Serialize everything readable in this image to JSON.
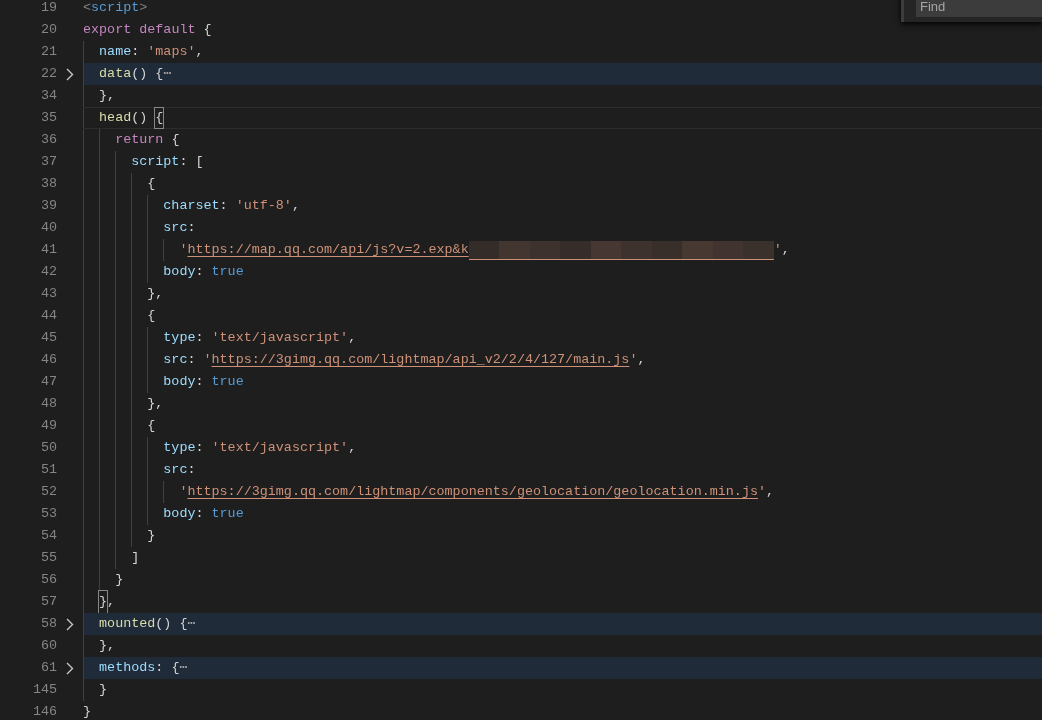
{
  "editor": {
    "lines": [
      {
        "number": "19",
        "folded": false,
        "current": false,
        "tokens": [
          {
            "kind": "tag-punct",
            "text": "<"
          },
          {
            "kind": "tag",
            "text": "script"
          },
          {
            "kind": "tag-punct",
            "text": ">"
          }
        ]
      },
      {
        "number": "20",
        "folded": false,
        "current": false,
        "tokens": [
          {
            "kind": "keyword",
            "text": "export"
          },
          {
            "kind": "keyword",
            "text": " default"
          },
          {
            "kind": "punct",
            "text": " {"
          }
        ]
      },
      {
        "number": "21",
        "folded": false,
        "current": false,
        "tokens": [
          {
            "kind": "property",
            "text": "  name"
          },
          {
            "kind": "punct",
            "text": ": "
          },
          {
            "kind": "string",
            "text": "'maps'"
          },
          {
            "kind": "punct",
            "text": ","
          }
        ]
      },
      {
        "number": "22",
        "folded": true,
        "current": false,
        "tokens": [
          {
            "kind": "function",
            "text": "  data"
          },
          {
            "kind": "punct",
            "text": "() {"
          },
          {
            "kind": "ellipsis",
            "text": "⋯"
          }
        ]
      },
      {
        "number": "34",
        "folded": false,
        "current": false,
        "tokens": [
          {
            "kind": "punct",
            "text": "  },"
          }
        ]
      },
      {
        "number": "35",
        "folded": false,
        "current": true,
        "tokens": [
          {
            "kind": "function",
            "text": "  head"
          },
          {
            "kind": "punct",
            "text": "() "
          },
          {
            "kind": "matched-bracket",
            "text": "{"
          }
        ]
      },
      {
        "number": "36",
        "folded": false,
        "current": false,
        "tokens": [
          {
            "kind": "keyword",
            "text": "    return"
          },
          {
            "kind": "punct",
            "text": " {"
          }
        ]
      },
      {
        "number": "37",
        "folded": false,
        "current": false,
        "tokens": [
          {
            "kind": "property",
            "text": "      script"
          },
          {
            "kind": "punct",
            "text": ": ["
          }
        ]
      },
      {
        "number": "38",
        "folded": false,
        "current": false,
        "tokens": [
          {
            "kind": "punct",
            "text": "        {"
          }
        ]
      },
      {
        "number": "39",
        "folded": false,
        "current": false,
        "tokens": [
          {
            "kind": "property",
            "text": "          charset"
          },
          {
            "kind": "punct",
            "text": ": "
          },
          {
            "kind": "string",
            "text": "'utf-8'"
          },
          {
            "kind": "punct",
            "text": ","
          }
        ]
      },
      {
        "number": "40",
        "folded": false,
        "current": false,
        "tokens": [
          {
            "kind": "property",
            "text": "          src"
          },
          {
            "kind": "punct",
            "text": ":"
          }
        ]
      },
      {
        "number": "41",
        "folded": false,
        "current": false,
        "tokens": [
          {
            "kind": "string",
            "text": "            '"
          },
          {
            "kind": "link",
            "text": "https://map.qq.com/api/js?v=2.exp&k"
          },
          {
            "kind": "redacted"
          },
          {
            "kind": "string",
            "text": "'"
          },
          {
            "kind": "punct",
            "text": ","
          }
        ]
      },
      {
        "number": "42",
        "folded": false,
        "current": false,
        "tokens": [
          {
            "kind": "property",
            "text": "          body"
          },
          {
            "kind": "punct",
            "text": ": "
          },
          {
            "kind": "boolean",
            "text": "true"
          }
        ]
      },
      {
        "number": "43",
        "folded": false,
        "current": false,
        "tokens": [
          {
            "kind": "punct",
            "text": "        },"
          }
        ]
      },
      {
        "number": "44",
        "folded": false,
        "current": false,
        "tokens": [
          {
            "kind": "punct",
            "text": "        {"
          }
        ]
      },
      {
        "number": "45",
        "folded": false,
        "current": false,
        "tokens": [
          {
            "kind": "property",
            "text": "          type"
          },
          {
            "kind": "punct",
            "text": ": "
          },
          {
            "kind": "string",
            "text": "'text/javascript'"
          },
          {
            "kind": "punct",
            "text": ","
          }
        ]
      },
      {
        "number": "46",
        "folded": false,
        "current": false,
        "tokens": [
          {
            "kind": "property",
            "text": "          src"
          },
          {
            "kind": "punct",
            "text": ": "
          },
          {
            "kind": "string",
            "text": "'"
          },
          {
            "kind": "link",
            "text": "https://3gimg.qq.com/lightmap/api_v2/2/4/127/main.js"
          },
          {
            "kind": "string",
            "text": "'"
          },
          {
            "kind": "punct",
            "text": ","
          }
        ]
      },
      {
        "number": "47",
        "folded": false,
        "current": false,
        "tokens": [
          {
            "kind": "property",
            "text": "          body"
          },
          {
            "kind": "punct",
            "text": ": "
          },
          {
            "kind": "boolean",
            "text": "true"
          }
        ]
      },
      {
        "number": "48",
        "folded": false,
        "current": false,
        "tokens": [
          {
            "kind": "punct",
            "text": "        },"
          }
        ]
      },
      {
        "number": "49",
        "folded": false,
        "current": false,
        "tokens": [
          {
            "kind": "punct",
            "text": "        {"
          }
        ]
      },
      {
        "number": "50",
        "folded": false,
        "current": false,
        "tokens": [
          {
            "kind": "property",
            "text": "          type"
          },
          {
            "kind": "punct",
            "text": ": "
          },
          {
            "kind": "string",
            "text": "'text/javascript'"
          },
          {
            "kind": "punct",
            "text": ","
          }
        ]
      },
      {
        "number": "51",
        "folded": false,
        "current": false,
        "tokens": [
          {
            "kind": "property",
            "text": "          src"
          },
          {
            "kind": "punct",
            "text": ":"
          }
        ]
      },
      {
        "number": "52",
        "folded": false,
        "current": false,
        "tokens": [
          {
            "kind": "string",
            "text": "            '"
          },
          {
            "kind": "link",
            "text": "https://3gimg.qq.com/lightmap/components/geolocation/geolocation.min.js"
          },
          {
            "kind": "string",
            "text": "'"
          },
          {
            "kind": "punct",
            "text": ","
          }
        ]
      },
      {
        "number": "53",
        "folded": false,
        "current": false,
        "tokens": [
          {
            "kind": "property",
            "text": "          body"
          },
          {
            "kind": "punct",
            "text": ": "
          },
          {
            "kind": "boolean",
            "text": "true"
          }
        ]
      },
      {
        "number": "54",
        "folded": false,
        "current": false,
        "tokens": [
          {
            "kind": "punct",
            "text": "        }"
          }
        ]
      },
      {
        "number": "55",
        "folded": false,
        "current": false,
        "tokens": [
          {
            "kind": "punct",
            "text": "      ]"
          }
        ]
      },
      {
        "number": "56",
        "folded": false,
        "current": false,
        "tokens": [
          {
            "kind": "punct",
            "text": "    }"
          }
        ]
      },
      {
        "number": "57",
        "folded": false,
        "current": false,
        "tokens": [
          {
            "kind": "matched-bracket",
            "text": "  }"
          },
          {
            "kind": "punct",
            "text": ","
          }
        ]
      },
      {
        "number": "58",
        "folded": true,
        "current": false,
        "tokens": [
          {
            "kind": "function",
            "text": "  mounted"
          },
          {
            "kind": "punct",
            "text": "() {"
          },
          {
            "kind": "ellipsis",
            "text": "⋯"
          }
        ]
      },
      {
        "number": "60",
        "folded": false,
        "current": false,
        "tokens": [
          {
            "kind": "punct",
            "text": "  },"
          }
        ]
      },
      {
        "number": "61",
        "folded": true,
        "current": false,
        "tokens": [
          {
            "kind": "property",
            "text": "  methods"
          },
          {
            "kind": "punct",
            "text": ": {"
          },
          {
            "kind": "ellipsis",
            "text": "⋯"
          }
        ]
      },
      {
        "number": "145",
        "folded": false,
        "current": false,
        "tokens": [
          {
            "kind": "punct",
            "text": "  }"
          }
        ]
      },
      {
        "number": "146",
        "folded": false,
        "current": false,
        "tokens": [
          {
            "kind": "punct",
            "text": "}"
          }
        ]
      }
    ]
  },
  "find_widget": {
    "placeholder": "Find"
  }
}
